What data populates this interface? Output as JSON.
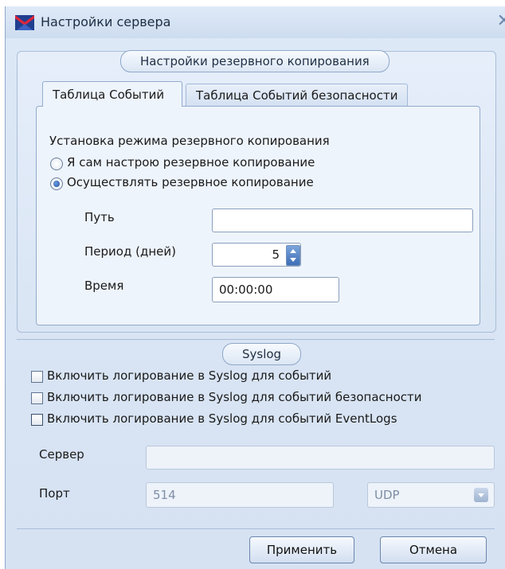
{
  "window": {
    "title": "Настройки сервера"
  },
  "backup": {
    "group_label": "Настройки резервного копирования",
    "tabs": [
      "Таблица Событий",
      "Таблица Событий безопасности"
    ],
    "mode_label": "Установка режима резервного копирования",
    "radio_manual": "Я сам настрою резервное копирование",
    "radio_auto": "Осуществлять резервное копирование",
    "selected_mode": "auto",
    "path_label": "Путь",
    "path_value": "",
    "period_label": "Период (дней)",
    "period_value": "5",
    "time_label": "Время",
    "time_value": "00:00:00"
  },
  "syslog": {
    "group_label": "Syslog",
    "checks": [
      {
        "label": "Включить логирование в Syslog для событий",
        "checked": false
      },
      {
        "label": "Включить логирование в Syslog для событий безопасности",
        "checked": false
      },
      {
        "label": "Включить логирование в Syslog для событий EventLogs",
        "checked": false
      }
    ],
    "server_label": "Сервер",
    "server_value": "",
    "port_label": "Порт",
    "port_value": "514",
    "protocol_value": "UDP"
  },
  "buttons": {
    "apply": "Применить",
    "cancel": "Отмена"
  },
  "colors": {
    "window_bg": "#d6e2f2",
    "accent": "#3d6eb6",
    "border": "#91abcd"
  }
}
